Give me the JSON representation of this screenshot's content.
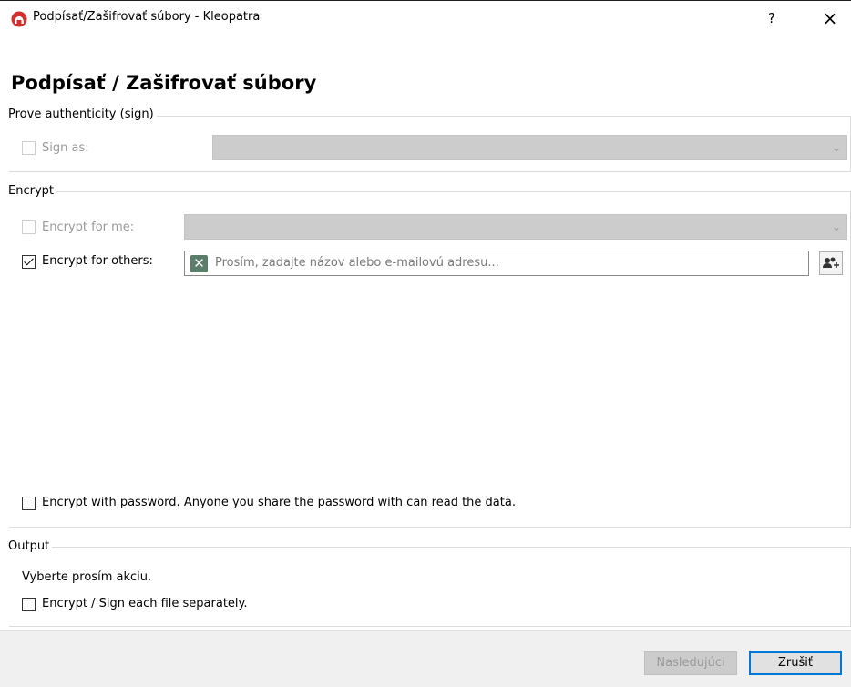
{
  "window": {
    "title": "Podpísať/Zašifrovať súbory - Kleopatra",
    "help_label": "?",
    "close_label": "×"
  },
  "heading": "Podpísať / Zašifrovať súbory",
  "sign_group": {
    "title": "Prove authenticity (sign)",
    "sign_as_label": "Sign as:",
    "sign_as_checked": false,
    "sign_as_value": ""
  },
  "encrypt_group": {
    "title": "Encrypt",
    "encrypt_for_me_label": "Encrypt for me:",
    "encrypt_for_me_checked": false,
    "encrypt_for_others_label": "Encrypt for others:",
    "encrypt_for_others_checked": true,
    "recipient_placeholder": "Prosím, zadajte názov alebo e-mailovú adresu...",
    "encrypt_with_password_label": "Encrypt with password. Anyone you share the password with can read the data.",
    "encrypt_with_password_checked": false
  },
  "output_group": {
    "title": "Output",
    "hint": "Vyberte prosím akciu.",
    "each_separately_label": "Encrypt / Sign each file separately.",
    "each_separately_checked": false
  },
  "footer": {
    "next_label": "Nasledujúci",
    "cancel_label": "Zrušiť"
  },
  "colors": {
    "accent": "#0078d7",
    "app_icon": "#d32f2f",
    "disabled_fill": "#cccccc"
  }
}
